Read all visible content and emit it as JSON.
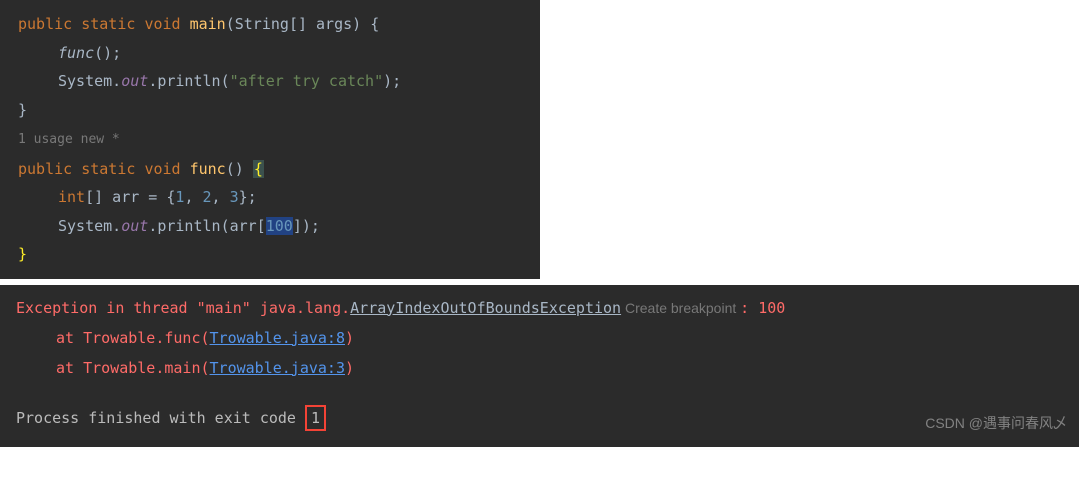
{
  "editor": {
    "lines": {
      "l1_kw1": "public",
      "l1_kw2": "static",
      "l1_kw3": "void",
      "l1_method": "main",
      "l1_lp": "(",
      "l1_type": "String",
      "l1_arr": "[] ",
      "l1_arg": "args",
      "l1_rp": ") {",
      "l2_func": "func",
      "l2_paren": "();",
      "l3_sys": "System.",
      "l3_out": "out",
      "l3_dot": ".",
      "l3_println": "println",
      "l3_lp": "(",
      "l3_str": "\"after try catch\"",
      "l3_rp": ");",
      "l4_brace": "}",
      "hint_usage": "1 usage",
      "hint_new": "   new *",
      "l5_kw1": "public",
      "l5_kw2": "static",
      "l5_kw3": "void",
      "l5_method": "func",
      "l5_paren": "() ",
      "l5_brace": "{",
      "l6_kw": "int",
      "l6_arr": "[] arr = {",
      "l6_n1": "1",
      "l6_c1": ", ",
      "l6_n2": "2",
      "l6_c2": ", ",
      "l6_n3": "3",
      "l6_close": "};",
      "l7_sys": "System.",
      "l7_out": "out",
      "l7_dot": ".",
      "l7_println": "println",
      "l7_lp": "(arr[",
      "l7_idx": "100",
      "l7_rp": "]);",
      "l8_brace": "}"
    }
  },
  "console": {
    "exc1": "Exception in thread \"main\" java.lang.",
    "exc_class": "ArrayIndexOutOfBoundsException",
    "create_bp": " Create breakpoint ",
    "colon": ": ",
    "idx": "100",
    "at1_pre": "at Trowable.func(",
    "at1_link": "Trowable.java:8",
    "at1_post": ")",
    "at2_pre": "at Trowable.main(",
    "at2_link": "Trowable.java:3",
    "at2_post": ")",
    "exit_pre": "Process finished with exit code ",
    "exit_code": "1",
    "watermark": "CSDN @遇事问春风乄"
  }
}
